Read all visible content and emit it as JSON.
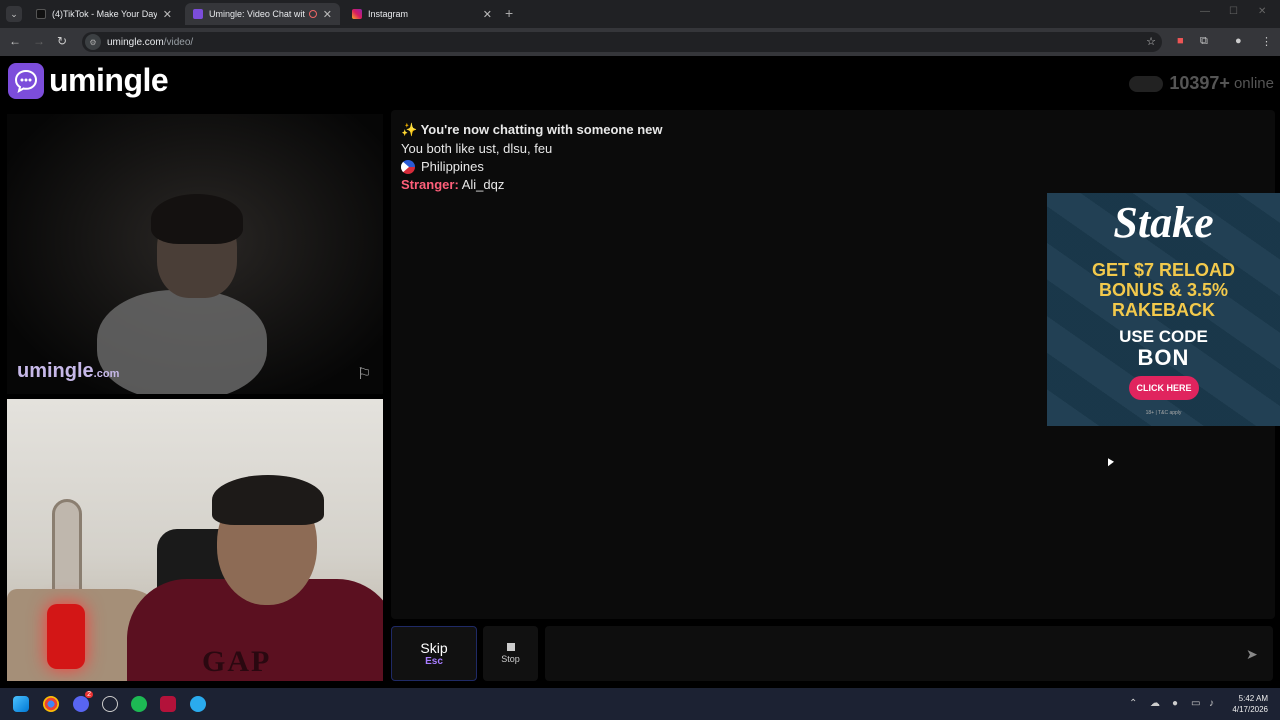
{
  "browser": {
    "tabs": [
      {
        "title": "(4)TikTok - Make Your Day",
        "close": "✕"
      },
      {
        "title": "Umingle: Video Chat with St",
        "close": "✕"
      },
      {
        "title": "Instagram",
        "close": "✕"
      }
    ],
    "new_tab": "+",
    "url_domain": "umingle.com",
    "url_path": "/video/"
  },
  "site": {
    "logo_text": "umingle",
    "online_count": "10397+",
    "online_label": "online",
    "watermark": "umingle",
    "watermark_suffix": ".com"
  },
  "chat": {
    "notice": "✨ You're now chatting with someone new",
    "interests": "You both like ust, dlsu, feu",
    "country": "Philippines",
    "stranger_label": "Stranger:",
    "stranger_name": "Ali_dqz"
  },
  "ad": {
    "brand": "Stake",
    "headline_1": "GET $7 RELOAD",
    "headline_2": "BONUS & 3.5%",
    "headline_3": "RAKEBACK",
    "use_code": "USE CODE",
    "code": "BON",
    "cta": "CLICK HERE",
    "fine_print": "18+ | T&C apply",
    "colors": {
      "bg": "#1b3a4e",
      "accent": "#f2c94c",
      "button": "#e0245e"
    }
  },
  "controls": {
    "skip_label": "Skip",
    "skip_shortcut": "Esc",
    "stop_label": "Stop",
    "message_placeholder": ""
  },
  "taskbar": {
    "time": "5:42 AM",
    "date": "4/17/2026",
    "discord_badge": "2"
  },
  "colors": {
    "brand": "#7c4ddb",
    "stranger": "#ff5f7a"
  }
}
